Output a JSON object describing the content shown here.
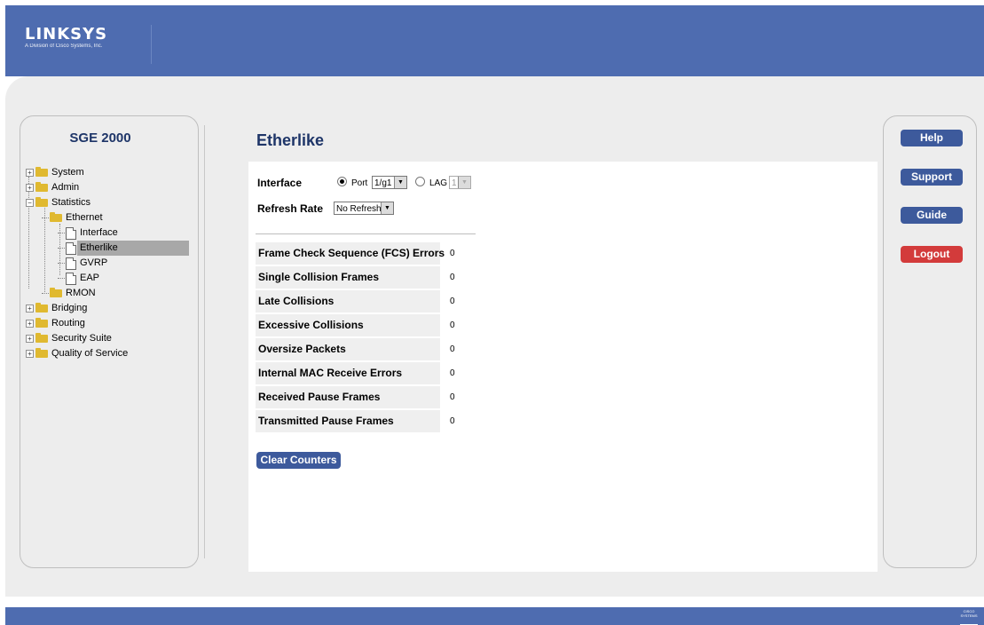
{
  "header": {
    "logo_text": "LINKSYS",
    "logo_subtitle": "A Division of Cisco Systems, Inc."
  },
  "sidebar": {
    "product": "SGE 2000",
    "tree": {
      "system": "System",
      "admin": "Admin",
      "statistics": "Statistics",
      "ethernet": "Ethernet",
      "interface": "Interface",
      "etherlike": "Etherlike",
      "gvrp": "GVRP",
      "eap": "EAP",
      "rmon": "RMON",
      "bridging": "Bridging",
      "routing": "Routing",
      "security_suite": "Security Suite",
      "qos": "Quality of Service"
    }
  },
  "main": {
    "title": "Etherlike",
    "interface_label": "Interface",
    "port_label": "Port",
    "port_value": "1/g1",
    "lag_label": "LAG",
    "lag_value": "1",
    "refresh_label": "Refresh Rate",
    "refresh_value": "No Refresh",
    "rows": [
      {
        "label": "Frame Check Sequence (FCS) Errors",
        "value": "0"
      },
      {
        "label": "Single Collision Frames",
        "value": "0"
      },
      {
        "label": "Late Collisions",
        "value": "0"
      },
      {
        "label": "Excessive Collisions",
        "value": "0"
      },
      {
        "label": "Oversize Packets",
        "value": "0"
      },
      {
        "label": "Internal MAC Receive Errors",
        "value": "0"
      },
      {
        "label": "Received Pause Frames",
        "value": "0"
      },
      {
        "label": "Transmitted Pause Frames",
        "value": "0"
      }
    ],
    "clear_button": "Clear Counters"
  },
  "right_buttons": {
    "help": "Help",
    "support": "Support",
    "guide": "Guide",
    "logout": "Logout"
  },
  "footer": {
    "cisco_text": "CISCO SYSTEMS"
  },
  "colors": {
    "brand_blue": "#4e6cb0",
    "button_blue": "#3d5a9c",
    "logout_red": "#d33b3b",
    "title_navy": "#1e3568"
  }
}
